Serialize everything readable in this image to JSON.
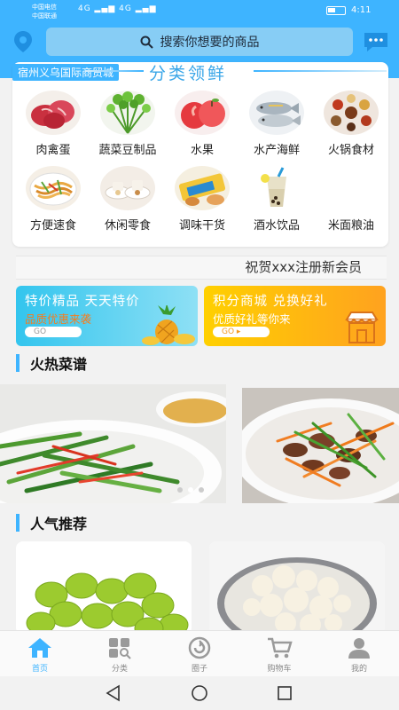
{
  "status": {
    "carrier1": "中国电信",
    "carrier2": "中国联通",
    "signal": "4G ▂▄▆ 4G ▂▄▆",
    "time": "4:11"
  },
  "header": {
    "search_placeholder": "搜索你想要的商品"
  },
  "categories": {
    "city_tag": "宿州义乌国际商贸城",
    "title": "分类领鲜",
    "items": [
      {
        "label": "肉禽蛋",
        "icon": "meat-icon"
      },
      {
        "label": "蔬菜豆制品",
        "icon": "vegetable-icon"
      },
      {
        "label": "水果",
        "icon": "fruit-icon"
      },
      {
        "label": "水产海鲜",
        "icon": "seafood-icon"
      },
      {
        "label": "火锅食材",
        "icon": "hotpot-icon"
      },
      {
        "label": "方便速食",
        "icon": "noodle-icon"
      },
      {
        "label": "休闲零食",
        "icon": "snack-icon"
      },
      {
        "label": "调味干货",
        "icon": "seasoning-icon"
      },
      {
        "label": "酒水饮品",
        "icon": "drink-icon"
      },
      {
        "label": "米面粮油",
        "icon": "grain-icon"
      }
    ]
  },
  "marquee": {
    "text": "祝贺xxx注册新会员"
  },
  "promos": [
    {
      "title": "特价精品  天天特价",
      "subtitle": "品质优惠来袭",
      "button": "GO"
    },
    {
      "title": "积分商城  兑换好礼",
      "subtitle": "优质好礼等你来",
      "button": "GO ▸"
    }
  ],
  "sections": {
    "recipes_title": "火热菜谱",
    "popular_title": "人气推荐"
  },
  "tabbar": {
    "items": [
      {
        "label": "首页",
        "icon": "home-icon",
        "active": true
      },
      {
        "label": "分类",
        "icon": "category-icon",
        "active": false
      },
      {
        "label": "圈子",
        "icon": "circle-icon",
        "active": false
      },
      {
        "label": "购物车",
        "icon": "cart-icon",
        "active": false
      },
      {
        "label": "我的",
        "icon": "profile-icon",
        "active": false
      }
    ]
  },
  "colors": {
    "brand": "#3eb4ff",
    "promo_left": "#33c5ee",
    "promo_right": "#ffb31a"
  }
}
